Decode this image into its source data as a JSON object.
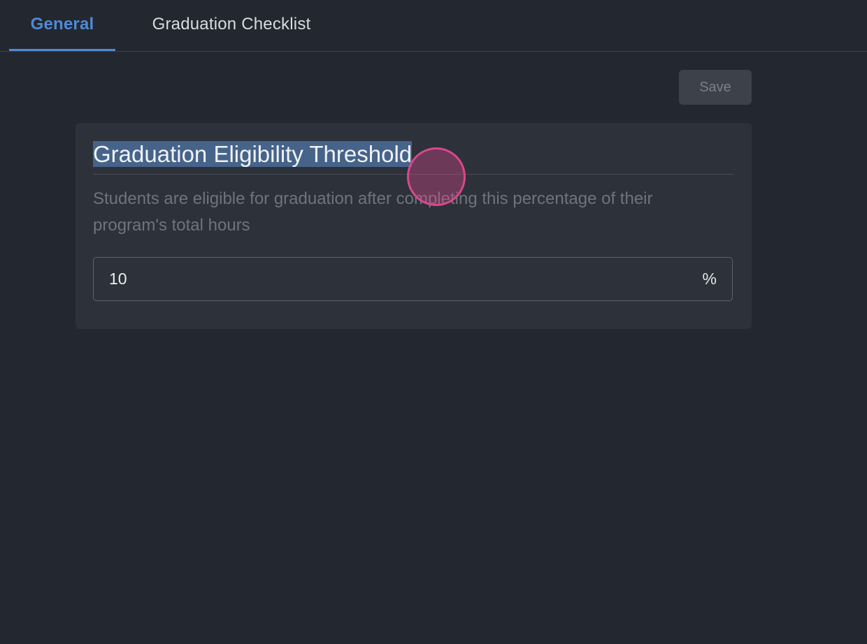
{
  "tabs": [
    {
      "label": "General",
      "active": true
    },
    {
      "label": "Graduation Checklist",
      "active": false
    }
  ],
  "toolbar": {
    "save_label": "Save"
  },
  "card": {
    "title": "Graduation Eligibility Threshold",
    "description": "Students are eligible for graduation after completing this percentage of their program's total hours",
    "threshold_value": "10",
    "threshold_suffix": "%"
  },
  "colors": {
    "background": "#23272f",
    "card": "#2d3139",
    "accent": "#4f8ad6",
    "cursor_highlight": "#d9478f"
  }
}
